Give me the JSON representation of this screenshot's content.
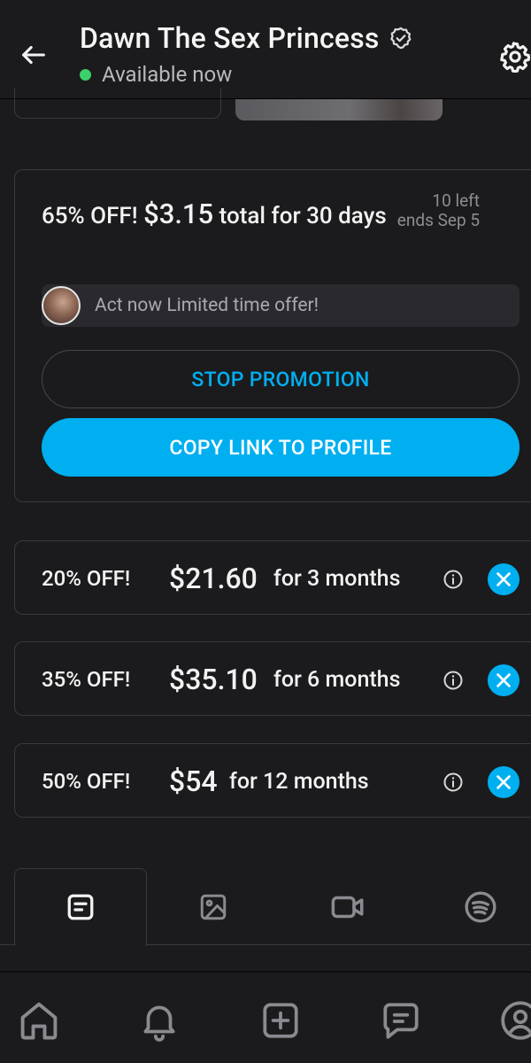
{
  "header": {
    "title": "Dawn The Sex Princess",
    "status": "Available now"
  },
  "promo": {
    "discount": "65% OFF!",
    "price": "$3.15",
    "period": "total for 30 days",
    "left": "10 left",
    "ends": "ends Sep 5",
    "message": "Act now Limited time offer!",
    "stop_label": "STOP PROMOTION",
    "copy_label": "COPY LINK TO PROFILE"
  },
  "bundles": [
    {
      "discount": "20% OFF!",
      "price": "$21.60",
      "period": "for 3 months"
    },
    {
      "discount": "35% OFF!",
      "price": "$35.10",
      "period": "for 6 months"
    },
    {
      "discount": "50% OFF!",
      "price": "$54",
      "period": "for 12 months"
    }
  ],
  "tabs": [
    {
      "icon": "posts-icon",
      "active": true
    },
    {
      "icon": "photos-icon",
      "active": false
    },
    {
      "icon": "videos-icon",
      "active": false
    },
    {
      "icon": "audio-icon",
      "active": false
    }
  ],
  "bottom_nav": [
    "home-icon",
    "notifications-icon",
    "add-icon",
    "messages-icon",
    "profile-icon"
  ],
  "colors": {
    "accent": "#00aff0",
    "background": "#1b1b1d",
    "online": "#3bd06a"
  }
}
